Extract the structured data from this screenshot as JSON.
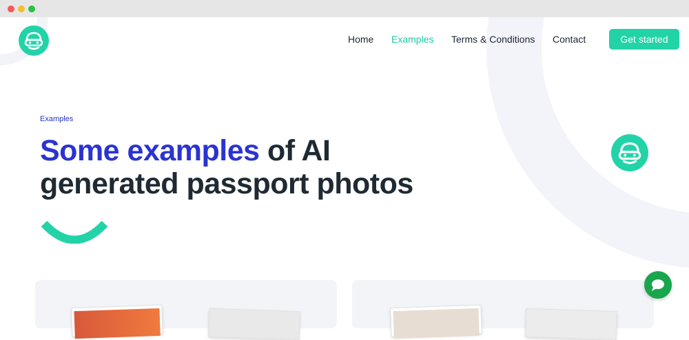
{
  "colors": {
    "brand": "#23d3a8",
    "accent": "#2b34d0",
    "text": "#1f2a33",
    "chat": "#19a54c"
  },
  "header": {
    "logo_icon": "masked-bandit-icon",
    "nav": {
      "home": "Home",
      "examples": "Examples",
      "terms": "Terms & Conditions",
      "contact": "Contact"
    },
    "cta": "Get started"
  },
  "hero": {
    "eyebrow": "Examples",
    "title_accent": "Some examples",
    "title_rest": " of AI generated passport photos",
    "badge_icon": "masked-bandit-icon"
  },
  "chat": {
    "icon": "chat-bubble-icon"
  }
}
